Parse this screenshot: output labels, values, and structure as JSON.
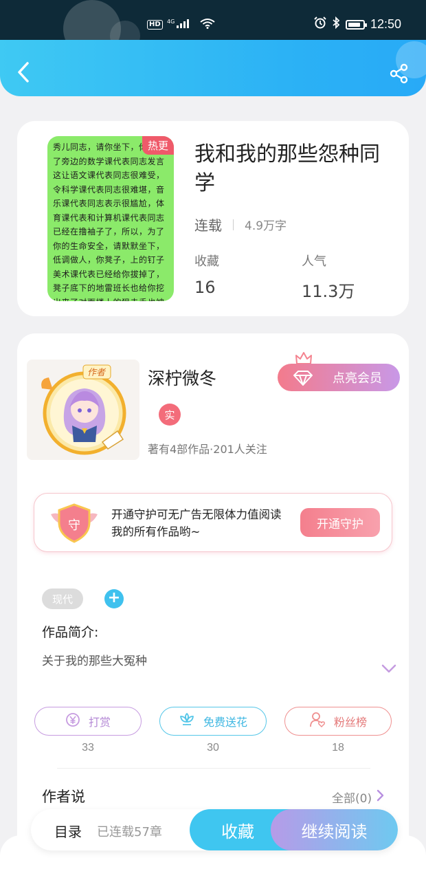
{
  "status_bar": {
    "network": "4G",
    "hd": "HD",
    "time": "12:50"
  },
  "header": {
    "back_icon": "chevron-left-icon",
    "share_icon": "share-icon"
  },
  "book": {
    "hot_tag": "热更",
    "title": "我和我的那些怨种同学",
    "status": "连载",
    "word_count": "4.9万字",
    "favorites_label": "收藏",
    "favorites_value": "16",
    "popularity_label": "人气",
    "popularity_value": "11.3万",
    "cover_text": "秀儿同志，请你坐下，你挡住了旁边的数学课代表同志发言这让语文课代表同志很难受，令科学课代表同志很难堪，音乐课代表同志表示很尴尬，体育课代表和计算机课代表同志已经在撸袖子了，所以，为了你的生命安全，请默默坐下，低调做人，你凳子，上的钉子美术课代表已经给你拔掉了，凳子底下的地雷班长也给你挖出来了对面楼上的狙击手也被副班长击毙了，下水道里的特务也被学习委员淹死了，凳子，上的胶水也被卫生委员擦掉了，现在你可以放心坐下了"
  },
  "author": {
    "avatar_badge": "作者",
    "name": "深柠微冬",
    "vip_button": "点亮会员",
    "real_badge": "实",
    "stats": "著有4部作品·201人关注"
  },
  "guard": {
    "text": "开通守护可无广告无限体力值阅读我的所有作品哟~",
    "icon_char": "守",
    "button": "开通守护"
  },
  "tags": {
    "items": [
      "现代"
    ],
    "add": "+"
  },
  "intro": {
    "title": "作品简介:",
    "text": "关于我的那些大冤种"
  },
  "actions": [
    {
      "label": "打赏",
      "count": "33",
      "icon": "yen-coin-icon"
    },
    {
      "label": "免费送花",
      "count": "30",
      "icon": "flower-icon"
    },
    {
      "label": "粉丝榜",
      "count": "18",
      "icon": "fan-user-icon"
    }
  ],
  "author_says": {
    "title": "作者说",
    "all": "全部(0)"
  },
  "bottom_bar": {
    "toc": "目录",
    "chapters": "已连载57章",
    "collect": "收藏",
    "read": "继续阅读"
  },
  "colors": {
    "accent_blue": "#3fc6f0",
    "pink": "#f36c7a",
    "cover_green": "#8bea6a"
  }
}
